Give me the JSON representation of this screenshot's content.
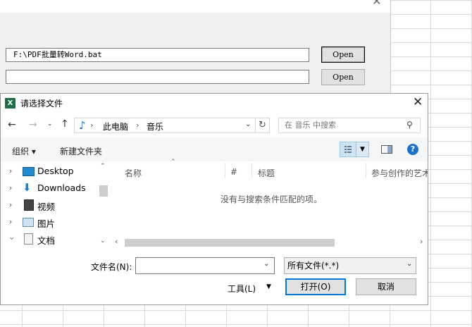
{
  "parent_dialog": {
    "path1_value": "F:\\PDF批量转Word.bat",
    "path2_value": "",
    "open1_label": "Open",
    "open2_label": "Open"
  },
  "file_dialog": {
    "title": "请选择文件",
    "icon_letter": "X",
    "breadcrumb": [
      "此电脑",
      "音乐"
    ],
    "breadcrumb_sep": "›",
    "search_placeholder": "在 音乐 中搜索",
    "toolbar": {
      "organize": "组织 ▾",
      "new_folder": "新建文件夹"
    },
    "nav_items": [
      {
        "label": "Desktop",
        "icon": "desktop-icon",
        "expanded": false
      },
      {
        "label": "Downloads",
        "icon": "downloads-icon",
        "expanded": false
      },
      {
        "label": "视频",
        "icon": "video-icon",
        "expanded": false
      },
      {
        "label": "图片",
        "icon": "pictures-icon",
        "expanded": false
      },
      {
        "label": "文档",
        "icon": "documents-icon",
        "expanded": true
      }
    ],
    "columns": [
      "名称",
      "#",
      "标题",
      "参与创作的艺术"
    ],
    "empty_message": "没有与搜索条件匹配的项。",
    "filename_label": "文件名(N):",
    "filename_value": "",
    "filter_value": "所有文件(*.*)",
    "tools_label": "工具(L)",
    "open_label": "打开(O)",
    "cancel_label": "取消"
  },
  "colors": {
    "accent": "#0078d7",
    "excel_green": "#1d6f42"
  }
}
